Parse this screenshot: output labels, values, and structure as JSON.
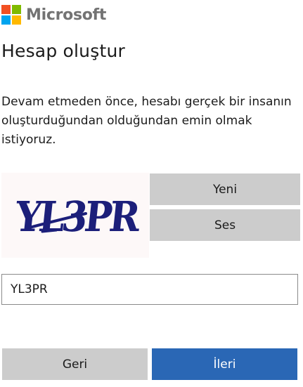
{
  "brand": {
    "name": "Microsoft",
    "logo_colors": [
      "#f25022",
      "#7fba00",
      "#00a4ef",
      "#ffb900"
    ]
  },
  "page": {
    "title": "Hesap oluştur",
    "description": "Devam etmeden önce, hesabı gerçek bir insanın oluşturduğundan olduğundan emin olmak istiyoruz."
  },
  "captcha": {
    "image_text": "YL3PR",
    "image_color": "#1c1f7a",
    "new_label": "Yeni",
    "audio_label": "Ses"
  },
  "input": {
    "value": "YL3PR"
  },
  "actions": {
    "back_label": "Geri",
    "next_label": "İleri",
    "accent_color": "#2a67b5"
  }
}
